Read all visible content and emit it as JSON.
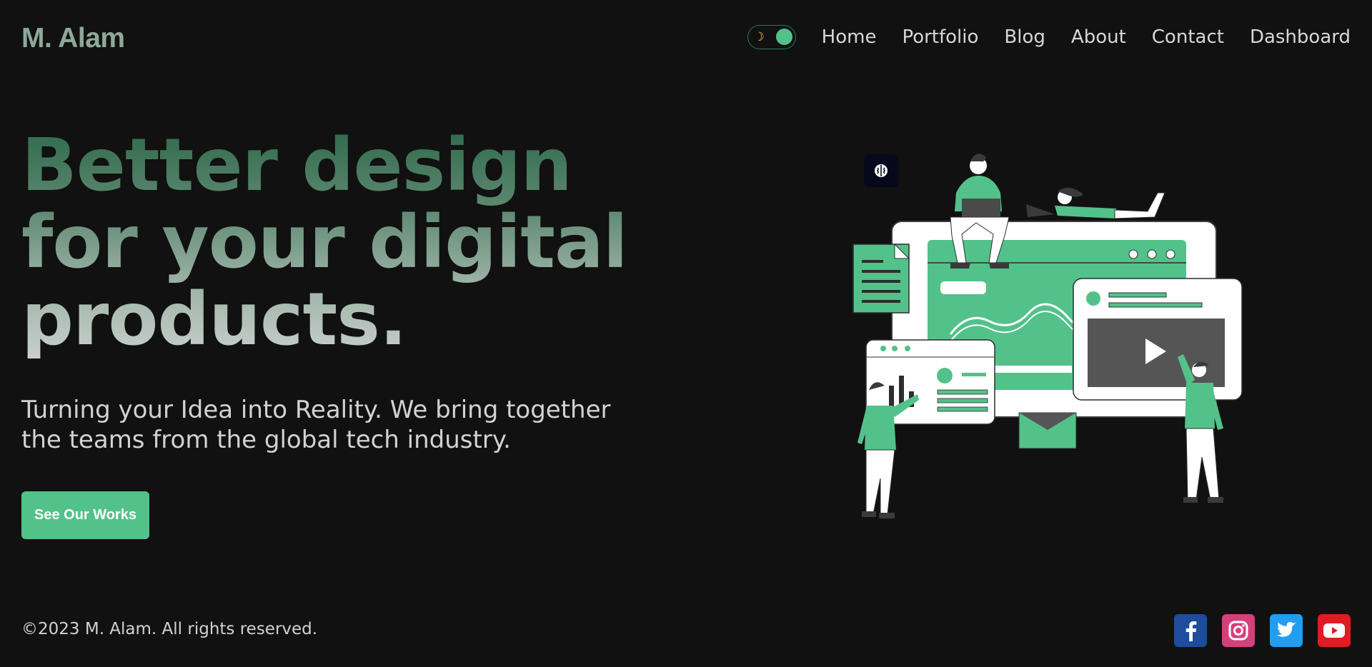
{
  "header": {
    "logo": "M. Alam",
    "theme_toggle": {
      "mode": "dark",
      "icon": "moon-icon"
    },
    "nav": [
      "Home",
      "Portfolio",
      "Blog",
      "About",
      "Contact",
      "Dashboard"
    ]
  },
  "hero": {
    "title_lines": [
      "Better design",
      "for your digital",
      "products."
    ],
    "subtitle": "Turning your Idea into Reality. We bring together the teams from the global tech industry.",
    "cta_label": "See Our Works"
  },
  "illustration": {
    "badge_icon": "brain-icon"
  },
  "footer": {
    "copyright": "©2023 M. Alam. All rights reserved.",
    "social": [
      {
        "name": "facebook-icon",
        "color": "#1d4d9b"
      },
      {
        "name": "instagram-icon",
        "color": "#d4417a"
      },
      {
        "name": "twitter-icon",
        "color": "#229ef0"
      },
      {
        "name": "youtube-icon",
        "color": "#e01c22"
      }
    ]
  },
  "colors": {
    "background": "#111111",
    "accent": "#52c28a",
    "logo": "#8fa89a"
  }
}
